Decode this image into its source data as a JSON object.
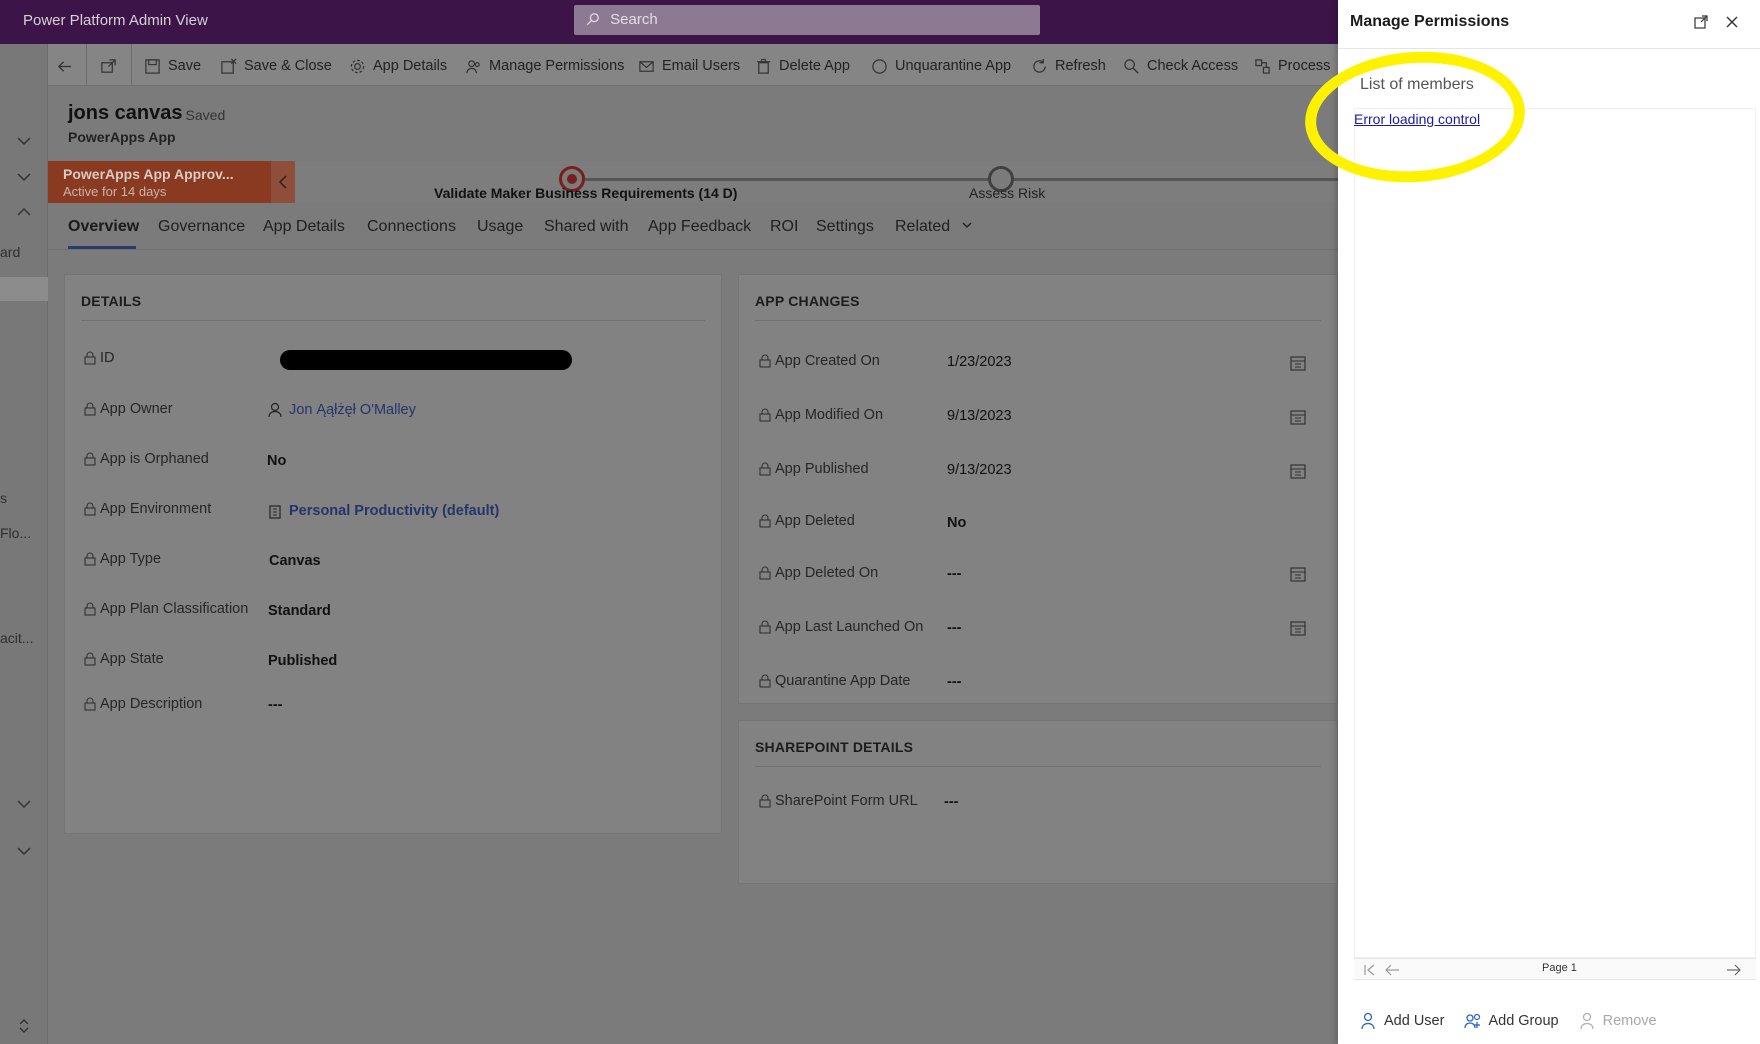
{
  "topbar": {
    "app_title": "Power Platform Admin View",
    "search_placeholder": "Search"
  },
  "rail_peek": {
    "item1": "ard",
    "item2": "s",
    "item3": "Flo...",
    "item4": "acit..."
  },
  "commands": {
    "save": "Save",
    "save_close": "Save & Close",
    "app_details": "App Details",
    "manage_permissions": "Manage Permissions",
    "email_users": "Email Users",
    "delete_app": "Delete App",
    "unquarantine_app": "Unquarantine App",
    "refresh": "Refresh",
    "check_access": "Check Access",
    "process": "Process"
  },
  "record": {
    "name": "jons canvas",
    "saved": "- Saved",
    "type": "PowerApps App"
  },
  "bpf": {
    "active_stage_title": "PowerApps App Approv...",
    "active_stage_sub": "Active for 14 days",
    "stage1": "Validate Maker Business Requirements  (14 D)",
    "stage2": "Assess Risk"
  },
  "tabs": [
    "Overview",
    "Governance",
    "App Details",
    "Connections",
    "Usage",
    "Shared with",
    "App Feedback",
    "ROI",
    "Settings",
    "Related"
  ],
  "details": {
    "title": "DETAILS",
    "fields": [
      {
        "label": "ID",
        "value": ""
      },
      {
        "label": "App Owner",
        "value": "Jon Ąąłżęł O'Malley"
      },
      {
        "label": "App is Orphaned",
        "value": "No"
      },
      {
        "label": "App Environment",
        "value": "Personal Productivity (default)"
      },
      {
        "label": "App Type",
        "value": "Canvas"
      },
      {
        "label": "App Plan Classification",
        "value": "Standard"
      },
      {
        "label": "App State",
        "value": "Published"
      },
      {
        "label": "App Description",
        "value": "---"
      }
    ]
  },
  "changes": {
    "title": "APP CHANGES",
    "fields": [
      {
        "label": "App Created On",
        "value": "1/23/2023"
      },
      {
        "label": "App Modified On",
        "value": "9/13/2023"
      },
      {
        "label": "App Published",
        "value": "9/13/2023"
      },
      {
        "label": "App Deleted",
        "value": "No"
      },
      {
        "label": "App Deleted On",
        "value": "---"
      },
      {
        "label": "App Last Launched On",
        "value": "---"
      },
      {
        "label": "Quarantine App Date",
        "value": "---"
      }
    ]
  },
  "sharepoint": {
    "title": "SHAREPOINT DETAILS",
    "label": "SharePoint Form URL",
    "value": "---"
  },
  "panel": {
    "title": "Manage Permissions",
    "members_label": "List of members",
    "error_text": "Error loading control",
    "page_text": "Page 1",
    "add_user": "Add User",
    "add_group": "Add Group",
    "remove": "Remove"
  },
  "colors": {
    "topbar": "#3c1448",
    "active_stage": "#8a3a20",
    "highlight": "#fff200",
    "link": "#1a1aa8"
  }
}
